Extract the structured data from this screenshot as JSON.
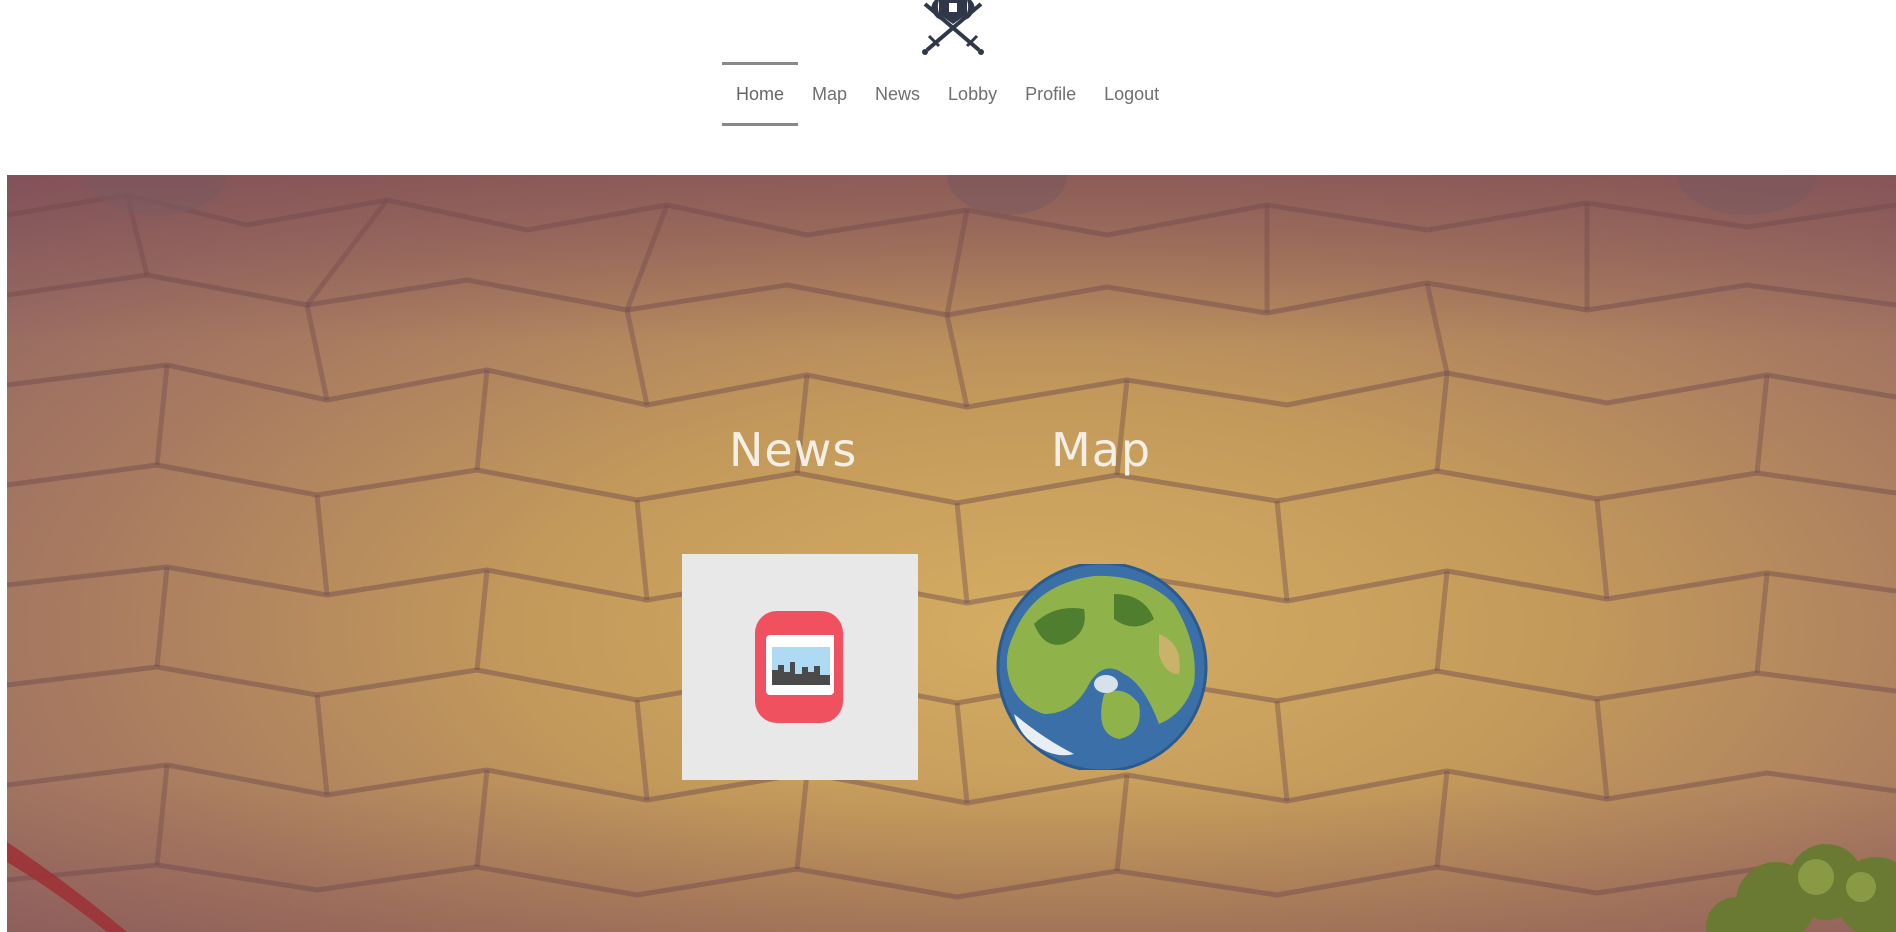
{
  "header": {
    "logo_icon": "crossed-swords-helmet-logo",
    "nav": [
      {
        "label": "Home",
        "active": true
      },
      {
        "label": "Map",
        "active": false
      },
      {
        "label": "News",
        "active": false
      },
      {
        "label": "Lobby",
        "active": false
      },
      {
        "label": "Profile",
        "active": false
      },
      {
        "label": "Logout",
        "active": false
      }
    ]
  },
  "hero": {
    "background": "cobblestone-floor-illustration",
    "tiles": [
      {
        "title": "News",
        "icon": "news-photo-icon"
      },
      {
        "title": "Map",
        "icon": "world-globe-map-icon"
      }
    ]
  },
  "colors": {
    "nav_text": "#6f6f6f",
    "nav_active_border": "#888888",
    "logo": "#2f3748",
    "title_text": "#f4efe6",
    "news_card_bg": "#e8e8e8",
    "news_icon_red": "#f0515f"
  }
}
